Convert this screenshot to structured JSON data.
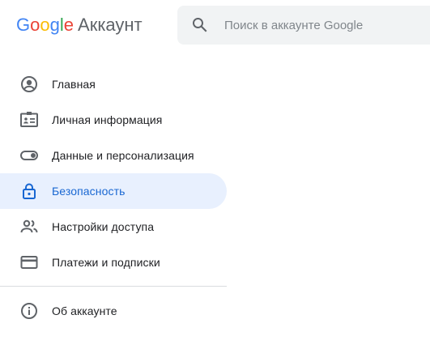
{
  "header": {
    "logo_letters": [
      {
        "char": "G",
        "color": "#4285f4"
      },
      {
        "char": "o",
        "color": "#ea4335"
      },
      {
        "char": "o",
        "color": "#fbbc05"
      },
      {
        "char": "g",
        "color": "#4285f4"
      },
      {
        "char": "l",
        "color": "#34a853"
      },
      {
        "char": "e",
        "color": "#ea4335"
      }
    ],
    "product_name": "Аккаунт"
  },
  "search": {
    "placeholder": "Поиск в аккаунте Google",
    "value": "",
    "icon": "search-icon"
  },
  "nav": {
    "items": [
      {
        "label": "Главная",
        "icon": "account-circle-icon",
        "active": false
      },
      {
        "label": "Личная информация",
        "icon": "id-card-icon",
        "active": false
      },
      {
        "label": "Данные и персонализация",
        "icon": "toggle-icon",
        "active": false
      },
      {
        "label": "Безопасность",
        "icon": "lock-icon",
        "active": true
      },
      {
        "label": "Настройки доступа",
        "icon": "people-icon",
        "active": false
      },
      {
        "label": "Платежи и подписки",
        "icon": "credit-card-icon",
        "active": false
      }
    ],
    "footer_items": [
      {
        "label": "Об аккаунте",
        "icon": "info-icon",
        "active": false
      }
    ]
  },
  "colors": {
    "active_bg": "#e8f0fe",
    "active_text": "#1967d2",
    "icon_default": "#5f6368",
    "text_default": "#202124",
    "search_bg": "#f1f3f4"
  }
}
